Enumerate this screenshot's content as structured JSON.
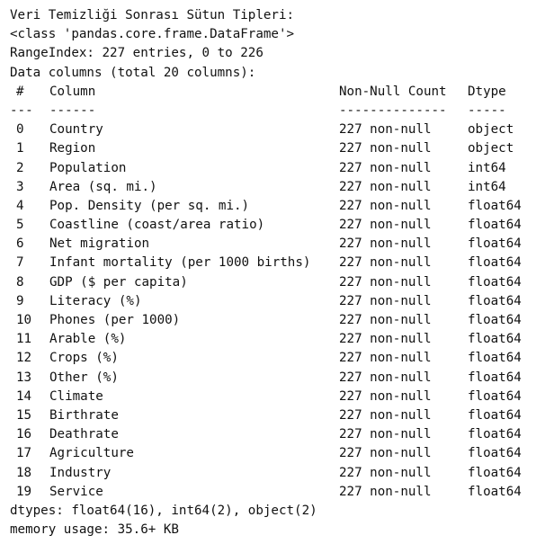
{
  "output": {
    "heading": "Veri Temizliği Sonrası Sütun Tipleri:",
    "class_line": "<class 'pandas.core.frame.DataFrame'>",
    "range_index": "RangeIndex: 227 entries, 0 to 226",
    "data_columns": "Data columns (total 20 columns):",
    "header": {
      "idx": "#",
      "column": "Column",
      "count": "Non-Null Count",
      "dtype": "Dtype"
    },
    "separator": {
      "idx": "---",
      "column": "------",
      "count": "--------------",
      "dtype": "-----"
    },
    "rows": [
      {
        "idx": "0",
        "column": "Country",
        "count": "227 non-null",
        "dtype": "object"
      },
      {
        "idx": "1",
        "column": "Region",
        "count": "227 non-null",
        "dtype": "object"
      },
      {
        "idx": "2",
        "column": "Population",
        "count": "227 non-null",
        "dtype": "int64"
      },
      {
        "idx": "3",
        "column": "Area (sq. mi.)",
        "count": "227 non-null",
        "dtype": "int64"
      },
      {
        "idx": "4",
        "column": "Pop. Density (per sq. mi.)",
        "count": "227 non-null",
        "dtype": "float64"
      },
      {
        "idx": "5",
        "column": "Coastline (coast/area ratio)",
        "count": "227 non-null",
        "dtype": "float64"
      },
      {
        "idx": "6",
        "column": "Net migration",
        "count": "227 non-null",
        "dtype": "float64"
      },
      {
        "idx": "7",
        "column": "Infant mortality (per 1000 births)",
        "count": "227 non-null",
        "dtype": "float64"
      },
      {
        "idx": "8",
        "column": "GDP ($ per capita)",
        "count": "227 non-null",
        "dtype": "float64"
      },
      {
        "idx": "9",
        "column": "Literacy (%)",
        "count": "227 non-null",
        "dtype": "float64"
      },
      {
        "idx": "10",
        "column": "Phones (per 1000)",
        "count": "227 non-null",
        "dtype": "float64"
      },
      {
        "idx": "11",
        "column": "Arable (%)",
        "count": "227 non-null",
        "dtype": "float64"
      },
      {
        "idx": "12",
        "column": "Crops (%)",
        "count": "227 non-null",
        "dtype": "float64"
      },
      {
        "idx": "13",
        "column": "Other (%)",
        "count": "227 non-null",
        "dtype": "float64"
      },
      {
        "idx": "14",
        "column": "Climate",
        "count": "227 non-null",
        "dtype": "float64"
      },
      {
        "idx": "15",
        "column": "Birthrate",
        "count": "227 non-null",
        "dtype": "float64"
      },
      {
        "idx": "16",
        "column": "Deathrate",
        "count": "227 non-null",
        "dtype": "float64"
      },
      {
        "idx": "17",
        "column": "Agriculture",
        "count": "227 non-null",
        "dtype": "float64"
      },
      {
        "idx": "18",
        "column": "Industry",
        "count": "227 non-null",
        "dtype": "float64"
      },
      {
        "idx": "19",
        "column": "Service",
        "count": "227 non-null",
        "dtype": "float64"
      }
    ],
    "dtypes_line": "dtypes: float64(16), int64(2), object(2)",
    "memory_line": "memory usage: 35.6+ KB"
  }
}
